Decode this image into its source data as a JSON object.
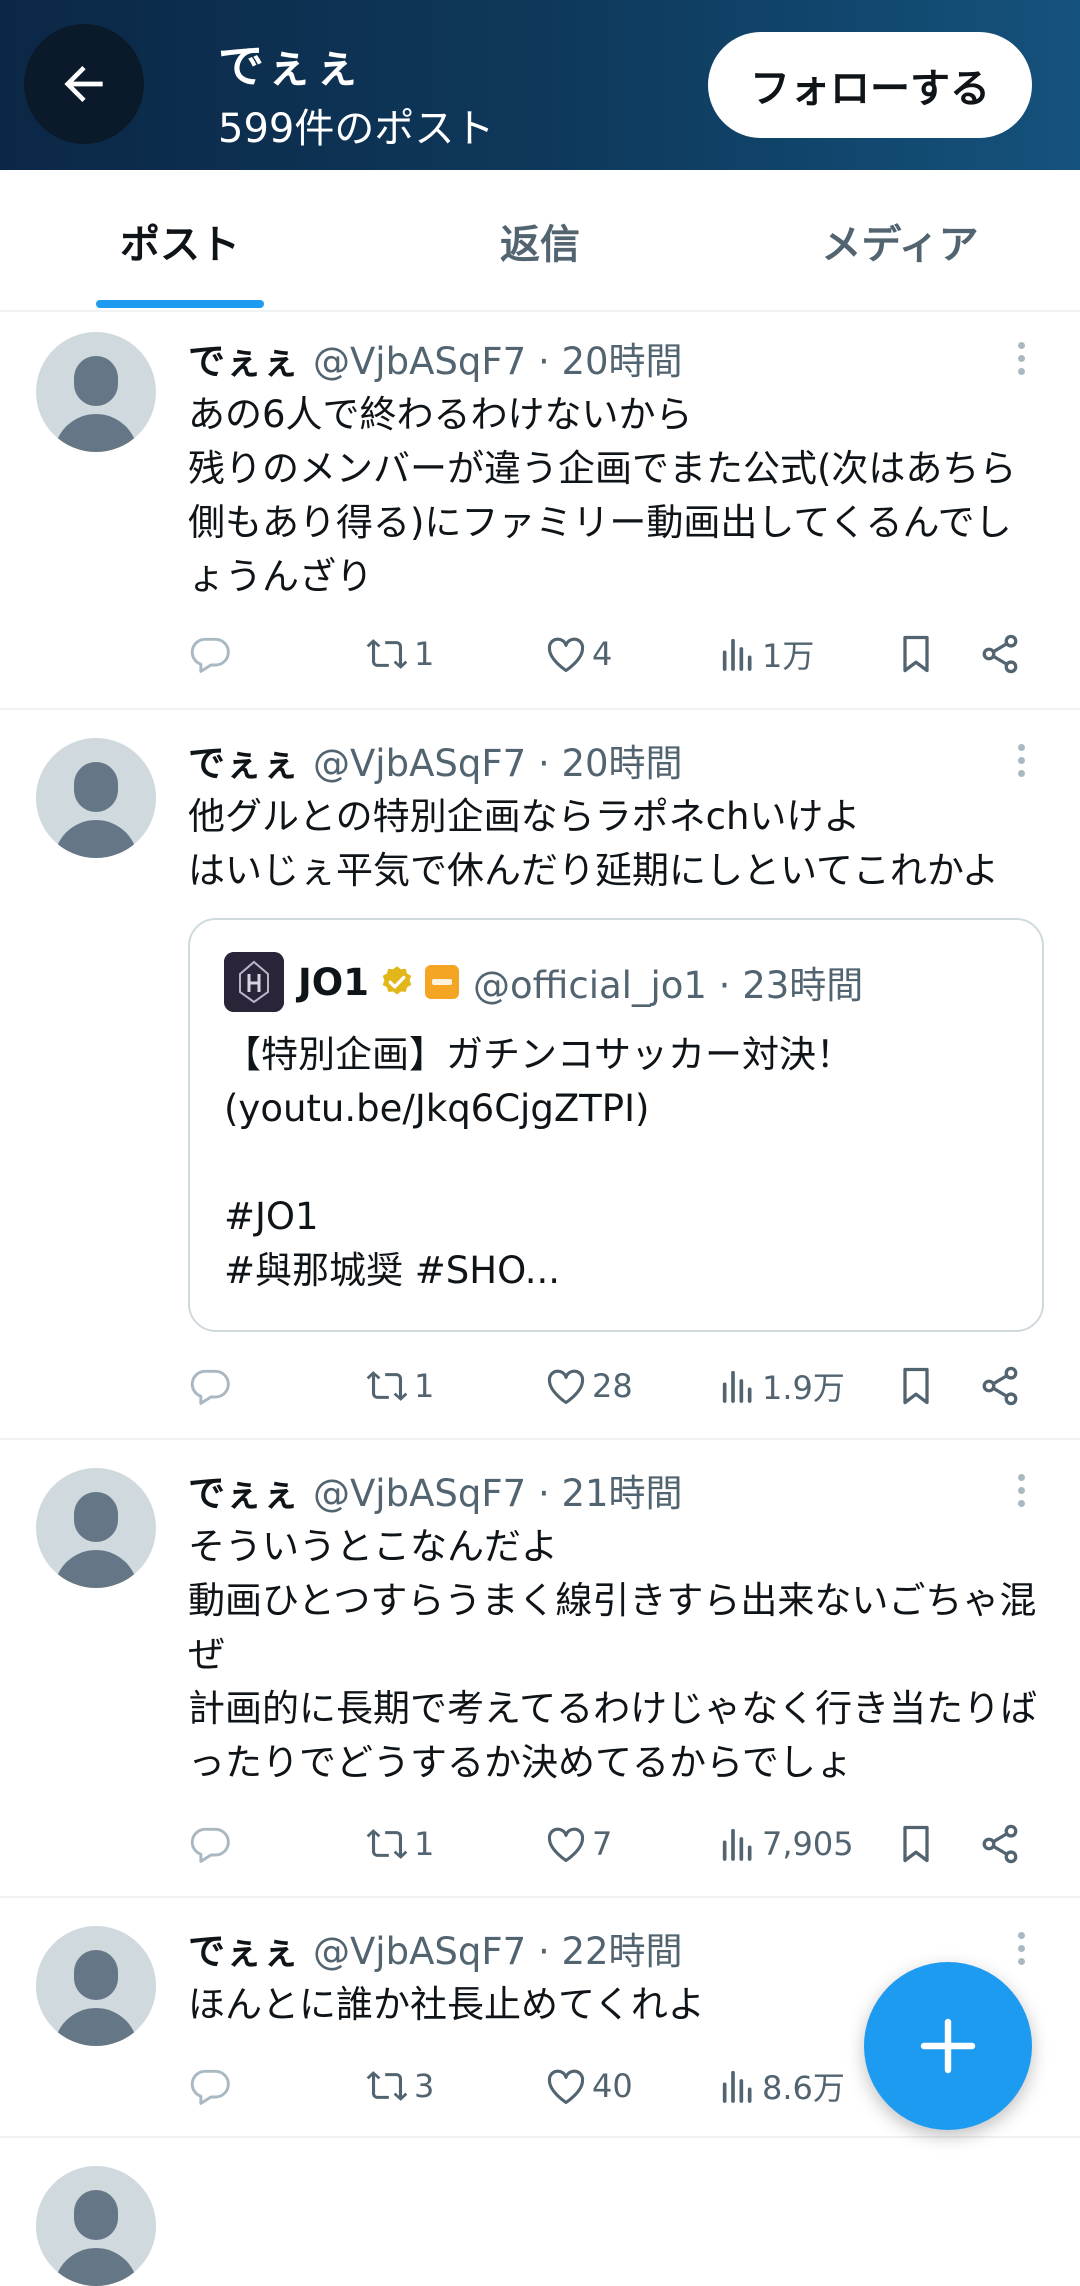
{
  "header": {
    "display_name": "でぇぇ",
    "post_count": "599件のポスト",
    "follow_label": "フォローする"
  },
  "tabs": [
    {
      "label": "ポスト",
      "active": true
    },
    {
      "label": "返信",
      "active": false
    },
    {
      "label": "メディア",
      "active": false
    }
  ],
  "colors": {
    "accent": "#1d9bf0",
    "header_dark": "#0c2746",
    "secondary_text": "#536471",
    "divider": "#eff3f4"
  },
  "tweets": [
    {
      "name": "でぇぇ",
      "handle_time": "@VjbASqF7 · 20時間",
      "text": "あの6人で終わるわけないから\n残りのメンバーが違う企画でまた公式(次はあちら側もあり得る)にファミリー動画出してくるんでしょうんざり",
      "reply_count": "",
      "retweet_count": "1",
      "like_count": "4",
      "view_count": "1万"
    },
    {
      "name": "でぇぇ",
      "handle_time": "@VjbASqF7 · 20時間",
      "text": "他グルとの特別企画ならラポネchいけよ\nはいじぇ平気で休んだり延期にしといてこれかよ",
      "quote": {
        "name": "JO1",
        "handle_time": "@official_jo1 · 23時間",
        "text": "【特別企画】ガチンコサッカー対決！\n(youtu.be/Jkq6CjgZTPI)\n\n#JO1\n#與那城奨 #SHO..."
      },
      "reply_count": "",
      "retweet_count": "1",
      "like_count": "28",
      "view_count": "1.9万"
    },
    {
      "name": "でぇぇ",
      "handle_time": "@VjbASqF7 · 21時間",
      "text": "そういうとこなんだよ\n動画ひとつすらうまく線引きすら出来ないごちゃ混ぜ\n計画的に長期で考えてるわけじゃなく行き当たりばったりでどうするか決めてるからでしょ",
      "reply_count": "",
      "retweet_count": "1",
      "like_count": "7",
      "view_count": "7,905"
    },
    {
      "name": "でぇぇ",
      "handle_time": "@VjbASqF7 · 22時間",
      "text": "ほんとに誰か社長止めてくれよ",
      "reply_count": "",
      "retweet_count": "3",
      "like_count": "40",
      "view_count": "8.6万"
    }
  ],
  "icons": {
    "back": "arrow-left-icon",
    "reply": "reply-bubble-icon",
    "retweet": "retweet-icon",
    "like": "heart-icon",
    "views": "views-chart-icon",
    "bookmark": "bookmark-icon",
    "share": "share-icon",
    "compose": "plus-icon"
  }
}
